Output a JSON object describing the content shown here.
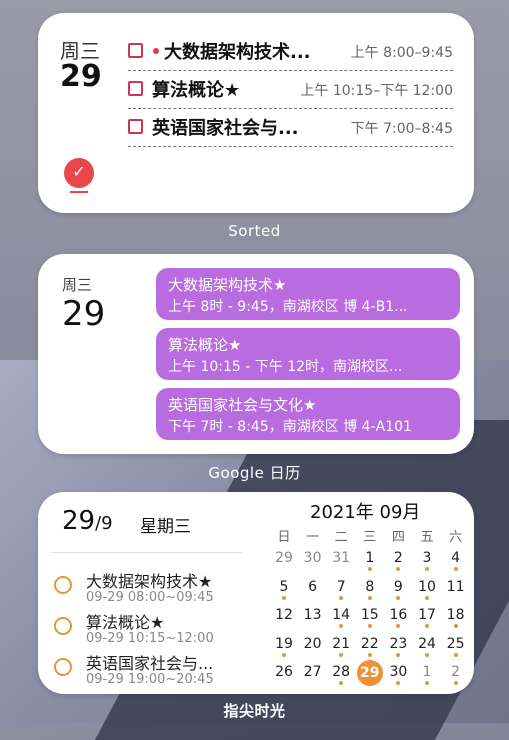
{
  "widget_sorted": {
    "weekday": "周三",
    "day": "29",
    "app_label": "Sorted",
    "events": [
      {
        "title": "大数据架构技术...",
        "time": "上午 8:00–9:45",
        "dot": true
      },
      {
        "title": "算法概论★",
        "time": "上午 10:15–下午 12:00",
        "dot": false
      },
      {
        "title": "英语国家社会与...",
        "time": "下午 7:00–8:45",
        "dot": false
      }
    ],
    "accent_color": "#e8484c"
  },
  "widget_google": {
    "weekday": "周三",
    "day": "29",
    "app_label": "Google 日历",
    "events": [
      {
        "title": "大数据架构技术★",
        "detail": "上午 8时 - 9:45，南湖校区 博 4-B1..."
      },
      {
        "title": "算法概论★",
        "detail": "上午 10:15 - 下午 12时，南湖校区..."
      },
      {
        "title": "英语国家社会与文化★",
        "detail": "下午 7时 - 8:45，南湖校区 博 4-A101"
      }
    ],
    "event_color": "#b96be0"
  },
  "widget_zhijian": {
    "date_day": "29",
    "date_month": "/9",
    "weekday": "星期三",
    "app_label": "指尖时光",
    "tasks": [
      {
        "title": "大数据架构技术★",
        "time": "09-29 08:00~09:45"
      },
      {
        "title": "算法概论★",
        "time": "09-29 10:15~12:00"
      },
      {
        "title": "英语国家社会与...",
        "time": "09-29 19:00~20:45"
      }
    ],
    "calendar": {
      "title": "2021年 09月",
      "weekdays": [
        "日",
        "一",
        "二",
        "三",
        "四",
        "五",
        "六"
      ],
      "weeks": [
        [
          {
            "d": "29",
            "m": true,
            "dot": false
          },
          {
            "d": "30",
            "m": true,
            "dot": false
          },
          {
            "d": "31",
            "m": true,
            "dot": false
          },
          {
            "d": "1",
            "m": false,
            "dot": true
          },
          {
            "d": "2",
            "m": false,
            "dot": true
          },
          {
            "d": "3",
            "m": false,
            "dot": true
          },
          {
            "d": "4",
            "m": false,
            "dot": true
          }
        ],
        [
          {
            "d": "5",
            "m": false,
            "dot": true
          },
          {
            "d": "6",
            "m": false,
            "dot": false
          },
          {
            "d": "7",
            "m": false,
            "dot": true
          },
          {
            "d": "8",
            "m": false,
            "dot": true
          },
          {
            "d": "9",
            "m": false,
            "dot": true
          },
          {
            "d": "10",
            "m": false,
            "dot": true
          },
          {
            "d": "11",
            "m": false,
            "dot": false
          }
        ],
        [
          {
            "d": "12",
            "m": false,
            "dot": false
          },
          {
            "d": "13",
            "m": false,
            "dot": false
          },
          {
            "d": "14",
            "m": false,
            "dot": true
          },
          {
            "d": "15",
            "m": false,
            "dot": true
          },
          {
            "d": "16",
            "m": false,
            "dot": true
          },
          {
            "d": "17",
            "m": false,
            "dot": true
          },
          {
            "d": "18",
            "m": false,
            "dot": true
          }
        ],
        [
          {
            "d": "19",
            "m": false,
            "dot": true
          },
          {
            "d": "20",
            "m": false,
            "dot": false
          },
          {
            "d": "21",
            "m": false,
            "dot": true
          },
          {
            "d": "22",
            "m": false,
            "dot": true
          },
          {
            "d": "23",
            "m": false,
            "dot": true
          },
          {
            "d": "24",
            "m": false,
            "dot": true
          },
          {
            "d": "25",
            "m": false,
            "dot": true
          }
        ],
        [
          {
            "d": "26",
            "m": false,
            "dot": false
          },
          {
            "d": "27",
            "m": false,
            "dot": false
          },
          {
            "d": "28",
            "m": false,
            "dot": true
          },
          {
            "d": "29",
            "m": false,
            "dot": true,
            "today": true
          },
          {
            "d": "30",
            "m": false,
            "dot": true
          },
          {
            "d": "1",
            "m": true,
            "dot": true
          },
          {
            "d": "2",
            "m": true,
            "dot": true
          }
        ]
      ]
    },
    "accent_color": "#ef8f38"
  }
}
